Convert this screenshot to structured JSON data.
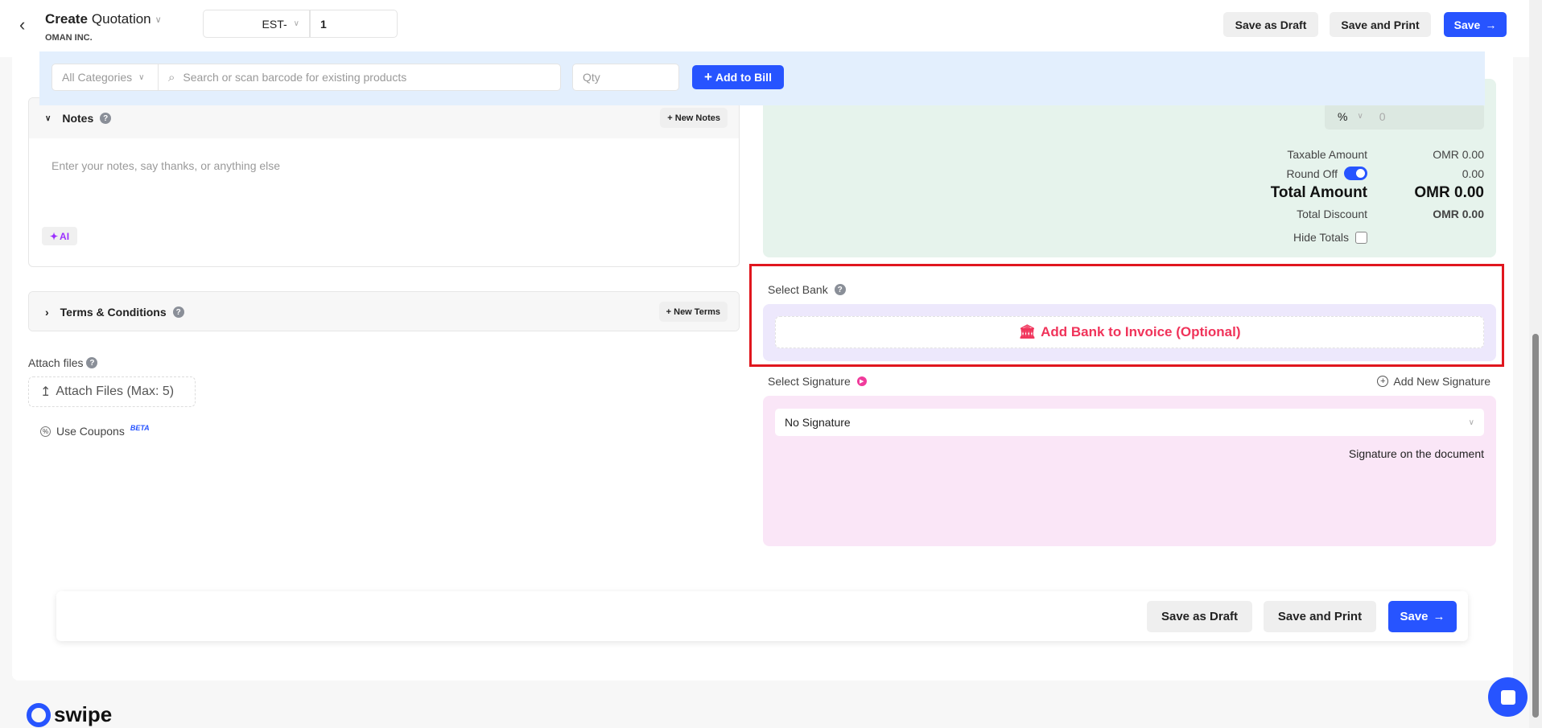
{
  "header": {
    "back_icon": "chevron-left-icon",
    "title_bold": "Create",
    "title": "Quotation",
    "company": "OMAN INC.",
    "prefix": "EST-",
    "number": "1",
    "save_draft": "Save as Draft",
    "save_print": "Save and Print",
    "save": "Save"
  },
  "product_bar": {
    "category": "All Categories",
    "search_placeholder": "Search or scan barcode for existing products",
    "qty_placeholder": "Qty",
    "add_label": "Add to Bill"
  },
  "notes": {
    "title": "Notes",
    "new_label": "New Notes",
    "placeholder": "Enter your notes, say thanks, or anything else",
    "ai_label": "AI"
  },
  "terms": {
    "title": "Terms & Conditions",
    "new_label": "New Terms"
  },
  "attach": {
    "label": "Attach files",
    "button": "Attach Files (Max: 5)"
  },
  "coupons": {
    "label": "Use Coupons",
    "badge": "BETA"
  },
  "totals": {
    "discount_type": "%",
    "discount_value": "0",
    "taxable_label": "Taxable Amount",
    "taxable_value": "OMR 0.00",
    "round_off_label": "Round Off",
    "round_off_on": true,
    "round_off_value": "0.00",
    "total_label": "Total Amount",
    "total_value": "OMR 0.00",
    "discount_label": "Total Discount",
    "discount_total": "OMR 0.00",
    "hide_totals_label": "Hide Totals"
  },
  "bank": {
    "label": "Select Bank",
    "add_label": "Add Bank to Invoice (Optional)"
  },
  "signature": {
    "label": "Select Signature",
    "add_label": "Add New Signature",
    "selected": "No Signature",
    "note": "Signature on the document"
  },
  "footer": {
    "save_draft": "Save as Draft",
    "save_print": "Save and Print",
    "save": "Save"
  },
  "brand": {
    "logo_text": "swipe"
  },
  "colors": {
    "accent": "#2754ff",
    "highlight": "#e0161e",
    "bank_text": "#f0335a"
  }
}
